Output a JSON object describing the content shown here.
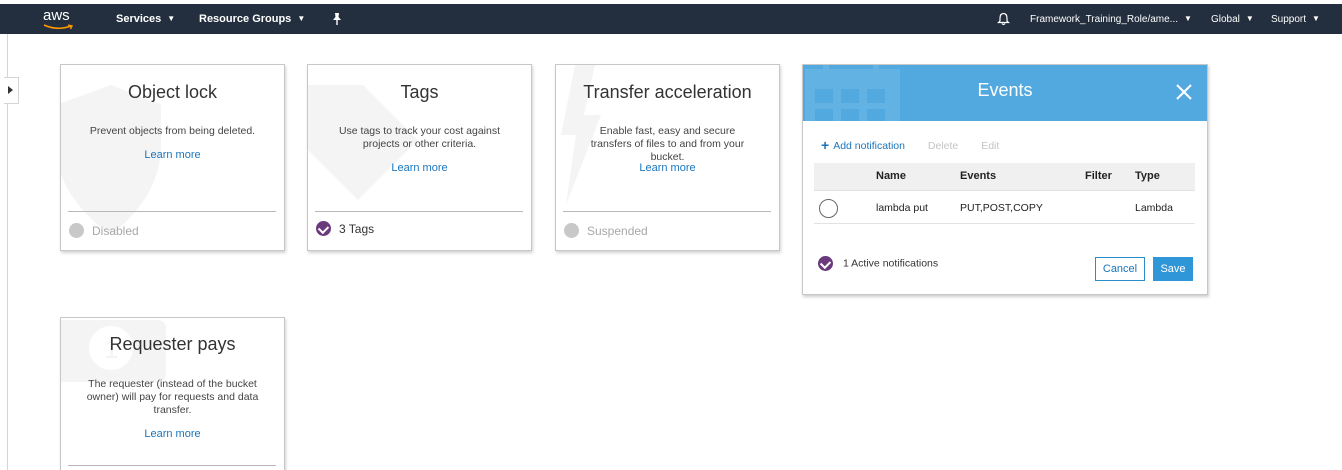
{
  "nav": {
    "logo_text": "aws",
    "services": "Services",
    "resource_groups": "Resource Groups",
    "role": "Framework_Training_Role/ame...",
    "region": "Global",
    "support": "Support"
  },
  "cards": {
    "object_lock": {
      "title": "Object lock",
      "description": "Prevent objects from being deleted.",
      "link": "Learn more",
      "status": "Disabled"
    },
    "tags": {
      "title": "Tags",
      "description": "Use tags to track your cost against projects or other criteria.",
      "link": "Learn more",
      "status": "3 Tags"
    },
    "transfer_acceleration": {
      "title": "Transfer acceleration",
      "description": "Enable fast, easy and secure transfers of files to and from your bucket.",
      "link": "Learn more",
      "status": "Suspended"
    },
    "requester_pays": {
      "title": "Requester pays",
      "description": "The requester (instead of the bucket owner) will pay for requests and data transfer.",
      "link": "Learn more"
    }
  },
  "events": {
    "title": "Events",
    "toolbar": {
      "add": "Add notification",
      "delete": "Delete",
      "edit": "Edit"
    },
    "columns": {
      "name": "Name",
      "events": "Events",
      "filter": "Filter",
      "type": "Type"
    },
    "rows": [
      {
        "name": "lambda put",
        "events": "PUT,POST,COPY",
        "filter": "",
        "type": "Lambda"
      }
    ],
    "active": "1 Active notifications",
    "cancel": "Cancel",
    "save": "Save"
  },
  "colors": {
    "nav_bg": "#232f3e",
    "header_blue": "#52a9df",
    "link_blue": "#1a75bb",
    "enabled_purple": "#6b3a7d",
    "disabled_gray": "#c8c8c8"
  },
  "icons": [
    "bell-icon",
    "pin-icon",
    "chevron-down-icon",
    "close-icon",
    "plus-icon",
    "check-icon",
    "expand-panel-icon"
  ]
}
